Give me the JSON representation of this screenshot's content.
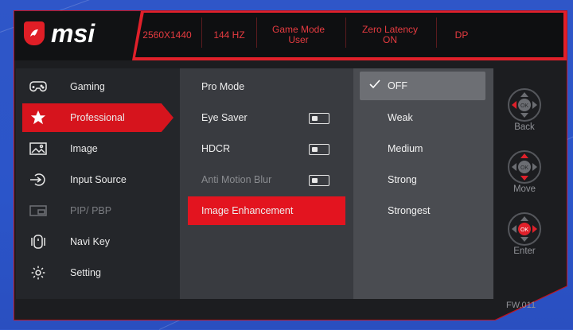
{
  "brand": {
    "name": "msi",
    "accent": "#e01e26"
  },
  "status": [
    {
      "line1": "2560X1440",
      "line2": ""
    },
    {
      "line1": "144 HZ",
      "line2": ""
    },
    {
      "line1": "Game Mode",
      "line2": "User"
    },
    {
      "line1": "Zero Latency",
      "line2": "ON"
    },
    {
      "line1": "DP",
      "line2": ""
    }
  ],
  "nav": [
    {
      "label": "Gaming",
      "icon": "gamepad-icon"
    },
    {
      "label": "Professional",
      "icon": "star-icon",
      "active": true
    },
    {
      "label": "Image",
      "icon": "image-icon"
    },
    {
      "label": "Input Source",
      "icon": "input-source-icon"
    },
    {
      "label": "PIP/ PBP",
      "icon": "pip-icon",
      "disabled": true
    },
    {
      "label": "Navi Key",
      "icon": "navi-key-icon"
    },
    {
      "label": "Setting",
      "icon": "gear-icon"
    }
  ],
  "professional": [
    {
      "label": "Pro Mode"
    },
    {
      "label": "Eye Saver",
      "toggle": "off"
    },
    {
      "label": "HDCR",
      "toggle": "off"
    },
    {
      "label": "Anti Motion Blur",
      "toggle": "off",
      "disabled": true
    },
    {
      "label": "Image Enhancement",
      "active": true
    }
  ],
  "options": [
    {
      "label": "OFF",
      "selected": true
    },
    {
      "label": "Weak"
    },
    {
      "label": "Medium"
    },
    {
      "label": "Strong"
    },
    {
      "label": "Strongest"
    }
  ],
  "controls": [
    {
      "label": "Back",
      "center": "OK"
    },
    {
      "label": "Move",
      "center": "OK"
    },
    {
      "label": "Enter",
      "center": "OK"
    }
  ],
  "firmware": "FW.011"
}
